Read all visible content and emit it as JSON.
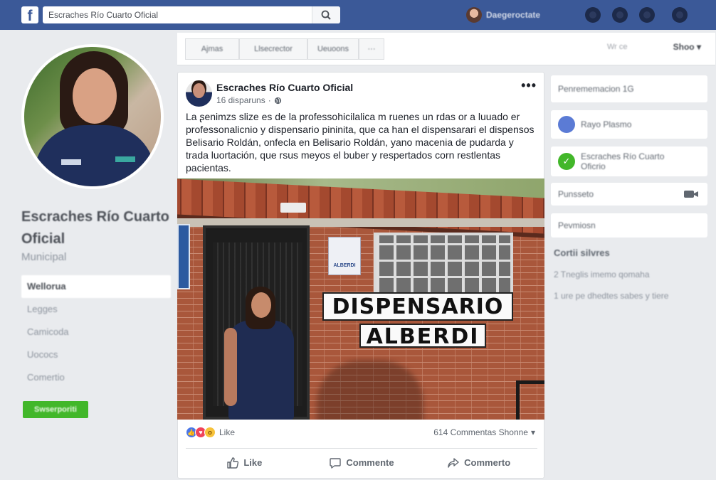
{
  "topbar": {
    "logo": "f",
    "search_value": "Escraches Río Cuarto Oficial",
    "user_name": "Daegeroctate",
    "colors": {
      "bar": "#3b5998",
      "logo_bg": "#ffffff"
    },
    "icons": [
      "search-icon",
      "friends-icon",
      "messages-icon",
      "notifications-icon",
      "help-icon"
    ]
  },
  "left": {
    "page_name": "Escraches Río Cuarto Oficial",
    "category": "Municipal",
    "nav": [
      "Wellorua",
      "Legges",
      "Camicoda",
      "Uococs",
      "Comertio"
    ],
    "button": "Swserporiti"
  },
  "action_bar": {
    "buttons": [
      "Ajmas",
      "Llsecrector",
      "Ueuoons",
      "···"
    ],
    "right_text": "Wr ce",
    "show_label": "Shoo"
  },
  "post": {
    "author": "Escraches Río Cuarto Oficial",
    "time": "16 disparuns",
    "more": "•••",
    "text": "La ʂenimzs slize es de la professohicilalica m ruenes un rdas or a luuado er professonalicnio y dispensario pininita, que ca han el dispensarari el dispensos Belisario Roldán, onfecla en Belisario Roldán, yano macenia de pudarda y trada luortación, que rsus meyos el buber y respertados corn restlentas pacientas.",
    "photo": {
      "sign_line1": "DISPENSARIO",
      "sign_line2": "ALBERDI",
      "plaque": "ALBERDI"
    },
    "reaction_label": "Like",
    "counts": "614 Commentas Shonne",
    "actions": [
      "Like",
      "Commente",
      "Commerto"
    ]
  },
  "right": {
    "boxes": [
      "Penrememacion 1G",
      "Rayo Plasmo",
      "Escraches Río Cuarto Oficrio",
      "Punsseto",
      "Pevmiosn"
    ],
    "section_title": "Cortii silvres",
    "lines": [
      "2 Tneglis imemo qomaha",
      "1 ure pe dhedtes sabes y tiere"
    ]
  }
}
